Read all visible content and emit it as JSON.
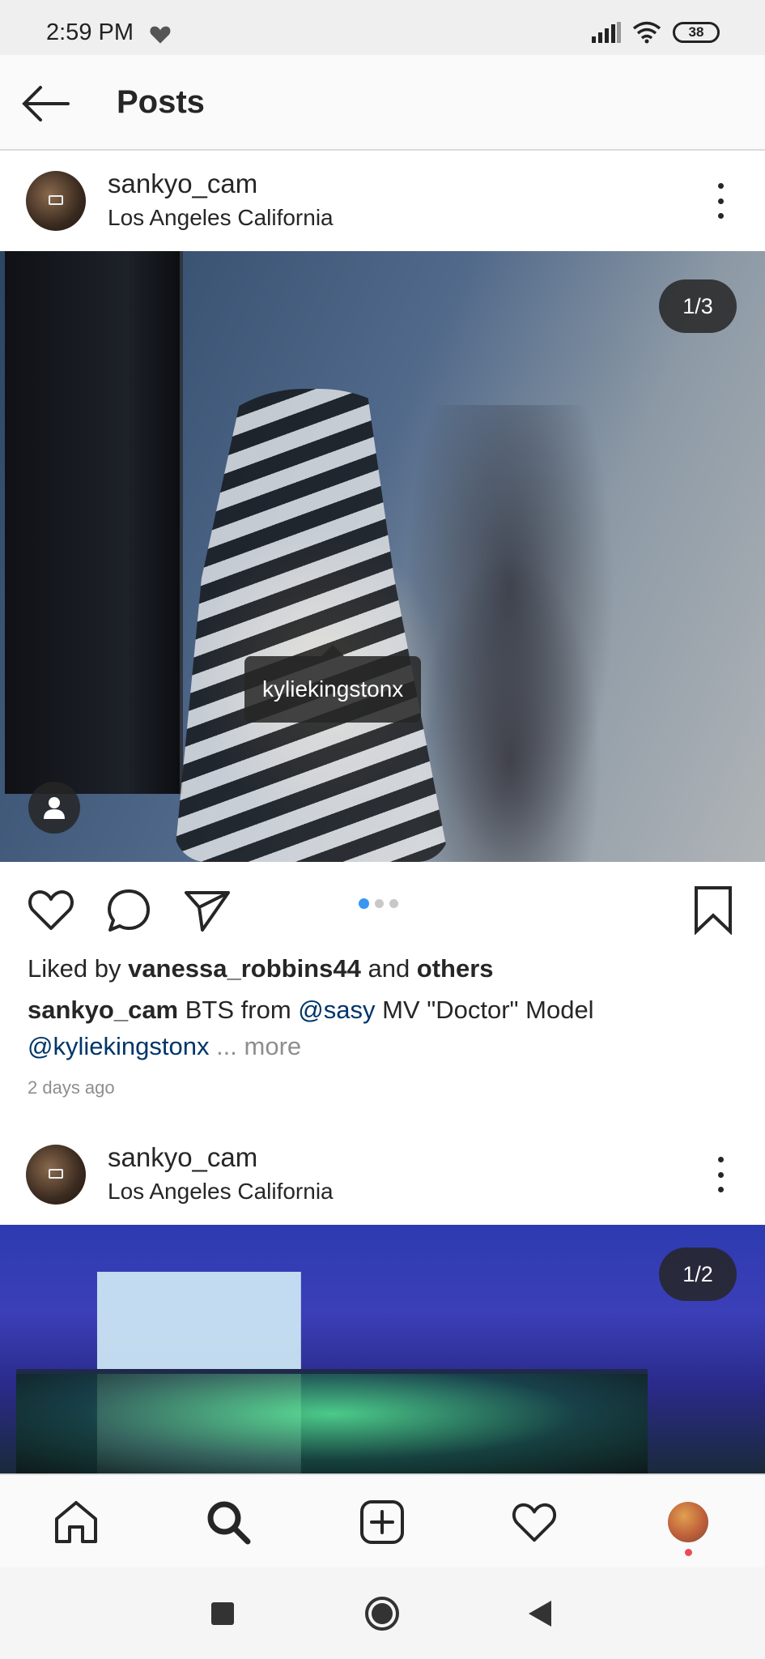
{
  "status_bar": {
    "time": "2:59 PM",
    "battery": "38"
  },
  "header": {
    "title": "Posts"
  },
  "posts": [
    {
      "username": "sankyo_cam",
      "location": "Los Angeles California",
      "slide_counter": "1/3",
      "tag": "kyliekingstonx",
      "liked_by_prefix": "Liked by ",
      "liked_by_user": "vanessa_robbins44",
      "liked_by_and": " and ",
      "liked_by_others": "others",
      "caption_user": "sankyo_cam",
      "caption_text_1": " BTS from ",
      "caption_mention_1": "@sasy",
      "caption_text_2": " MV \"Doctor\" Model ",
      "caption_mention_2": "@kyliekingstonx",
      "caption_more": " ... more",
      "time_ago": "2 days ago",
      "pager": {
        "count": 3,
        "active": 1
      }
    },
    {
      "username": "sankyo_cam",
      "location": "Los Angeles California",
      "slide_counter": "1/2"
    }
  ],
  "icons": {
    "heart": "heart-icon",
    "comment": "comment-icon",
    "share": "send-icon",
    "save": "bookmark-icon",
    "home": "home-icon",
    "search": "search-icon",
    "add": "add-post-icon",
    "activity": "activity-heart-icon"
  },
  "colors": {
    "link": "#003569",
    "accent_blue": "#3897f0",
    "notification_red": "#ed4956"
  }
}
